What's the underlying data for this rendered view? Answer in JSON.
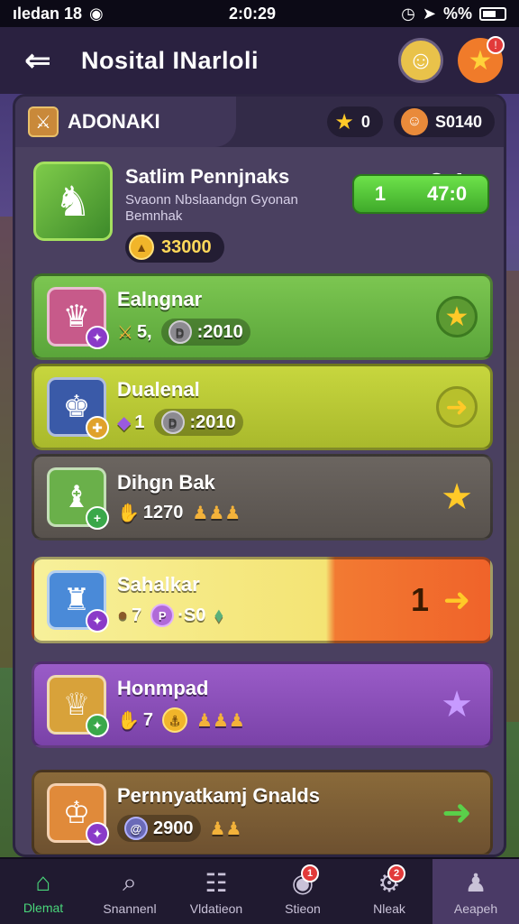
{
  "status_bar": {
    "carrier": "ıledan 18",
    "time": "2:0:29",
    "indicators": "%%"
  },
  "header": {
    "title": "Nosital INarloli"
  },
  "panel": {
    "tab_label": "ADONAKI",
    "stars": "0",
    "coins": "S0140"
  },
  "featured": {
    "name": "Satlim Pennjnaks",
    "desc_line1": "Svaonn Nbslaandgn Gyonan",
    "desc_line2": "Bemnhak",
    "coins": "33000",
    "rank": "3:1",
    "button_left": "1",
    "button_right": "47:0"
  },
  "rows": [
    {
      "name": "Ealngnar",
      "stat1": "5,",
      "stat2": ":2010"
    },
    {
      "name": "Dualenal",
      "stat1": "1",
      "stat2": ":2010"
    },
    {
      "name": "Dihgn Bak",
      "stat1": "1270",
      "stat2": ""
    },
    {
      "name": "Sahalkar",
      "stat1": "7",
      "stat2": "·S0",
      "rank": "1"
    },
    {
      "name": "Honmpad",
      "stat1": "7",
      "stat2": ""
    },
    {
      "name": "Pernnyatkamj Gnalds",
      "stat1": "2900",
      "stat2": ""
    }
  ],
  "bottom_nav": [
    {
      "label": "Dlemat"
    },
    {
      "label": "Snannenl"
    },
    {
      "label": "Vldatieon"
    },
    {
      "label": "Stieon",
      "badge": "1"
    },
    {
      "label": "Nleak",
      "badge": "2"
    },
    {
      "label": "Aeapeh"
    }
  ]
}
